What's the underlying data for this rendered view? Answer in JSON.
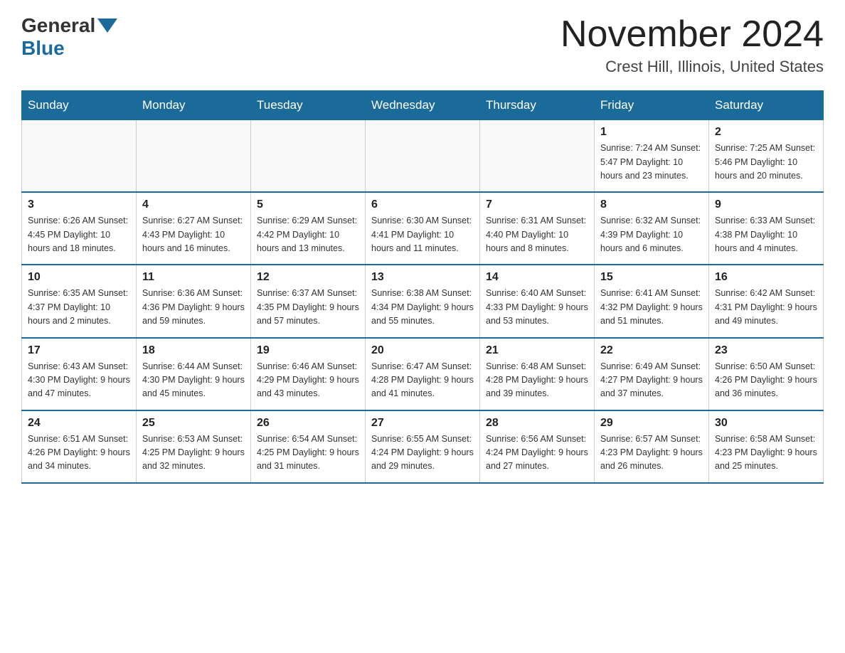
{
  "header": {
    "logo_general": "General",
    "logo_blue": "Blue",
    "month_year": "November 2024",
    "location": "Crest Hill, Illinois, United States"
  },
  "days_of_week": [
    "Sunday",
    "Monday",
    "Tuesday",
    "Wednesday",
    "Thursday",
    "Friday",
    "Saturday"
  ],
  "weeks": [
    [
      {
        "day": "",
        "info": ""
      },
      {
        "day": "",
        "info": ""
      },
      {
        "day": "",
        "info": ""
      },
      {
        "day": "",
        "info": ""
      },
      {
        "day": "",
        "info": ""
      },
      {
        "day": "1",
        "info": "Sunrise: 7:24 AM\nSunset: 5:47 PM\nDaylight: 10 hours and 23 minutes."
      },
      {
        "day": "2",
        "info": "Sunrise: 7:25 AM\nSunset: 5:46 PM\nDaylight: 10 hours and 20 minutes."
      }
    ],
    [
      {
        "day": "3",
        "info": "Sunrise: 6:26 AM\nSunset: 4:45 PM\nDaylight: 10 hours and 18 minutes."
      },
      {
        "day": "4",
        "info": "Sunrise: 6:27 AM\nSunset: 4:43 PM\nDaylight: 10 hours and 16 minutes."
      },
      {
        "day": "5",
        "info": "Sunrise: 6:29 AM\nSunset: 4:42 PM\nDaylight: 10 hours and 13 minutes."
      },
      {
        "day": "6",
        "info": "Sunrise: 6:30 AM\nSunset: 4:41 PM\nDaylight: 10 hours and 11 minutes."
      },
      {
        "day": "7",
        "info": "Sunrise: 6:31 AM\nSunset: 4:40 PM\nDaylight: 10 hours and 8 minutes."
      },
      {
        "day": "8",
        "info": "Sunrise: 6:32 AM\nSunset: 4:39 PM\nDaylight: 10 hours and 6 minutes."
      },
      {
        "day": "9",
        "info": "Sunrise: 6:33 AM\nSunset: 4:38 PM\nDaylight: 10 hours and 4 minutes."
      }
    ],
    [
      {
        "day": "10",
        "info": "Sunrise: 6:35 AM\nSunset: 4:37 PM\nDaylight: 10 hours and 2 minutes."
      },
      {
        "day": "11",
        "info": "Sunrise: 6:36 AM\nSunset: 4:36 PM\nDaylight: 9 hours and 59 minutes."
      },
      {
        "day": "12",
        "info": "Sunrise: 6:37 AM\nSunset: 4:35 PM\nDaylight: 9 hours and 57 minutes."
      },
      {
        "day": "13",
        "info": "Sunrise: 6:38 AM\nSunset: 4:34 PM\nDaylight: 9 hours and 55 minutes."
      },
      {
        "day": "14",
        "info": "Sunrise: 6:40 AM\nSunset: 4:33 PM\nDaylight: 9 hours and 53 minutes."
      },
      {
        "day": "15",
        "info": "Sunrise: 6:41 AM\nSunset: 4:32 PM\nDaylight: 9 hours and 51 minutes."
      },
      {
        "day": "16",
        "info": "Sunrise: 6:42 AM\nSunset: 4:31 PM\nDaylight: 9 hours and 49 minutes."
      }
    ],
    [
      {
        "day": "17",
        "info": "Sunrise: 6:43 AM\nSunset: 4:30 PM\nDaylight: 9 hours and 47 minutes."
      },
      {
        "day": "18",
        "info": "Sunrise: 6:44 AM\nSunset: 4:30 PM\nDaylight: 9 hours and 45 minutes."
      },
      {
        "day": "19",
        "info": "Sunrise: 6:46 AM\nSunset: 4:29 PM\nDaylight: 9 hours and 43 minutes."
      },
      {
        "day": "20",
        "info": "Sunrise: 6:47 AM\nSunset: 4:28 PM\nDaylight: 9 hours and 41 minutes."
      },
      {
        "day": "21",
        "info": "Sunrise: 6:48 AM\nSunset: 4:28 PM\nDaylight: 9 hours and 39 minutes."
      },
      {
        "day": "22",
        "info": "Sunrise: 6:49 AM\nSunset: 4:27 PM\nDaylight: 9 hours and 37 minutes."
      },
      {
        "day": "23",
        "info": "Sunrise: 6:50 AM\nSunset: 4:26 PM\nDaylight: 9 hours and 36 minutes."
      }
    ],
    [
      {
        "day": "24",
        "info": "Sunrise: 6:51 AM\nSunset: 4:26 PM\nDaylight: 9 hours and 34 minutes."
      },
      {
        "day": "25",
        "info": "Sunrise: 6:53 AM\nSunset: 4:25 PM\nDaylight: 9 hours and 32 minutes."
      },
      {
        "day": "26",
        "info": "Sunrise: 6:54 AM\nSunset: 4:25 PM\nDaylight: 9 hours and 31 minutes."
      },
      {
        "day": "27",
        "info": "Sunrise: 6:55 AM\nSunset: 4:24 PM\nDaylight: 9 hours and 29 minutes."
      },
      {
        "day": "28",
        "info": "Sunrise: 6:56 AM\nSunset: 4:24 PM\nDaylight: 9 hours and 27 minutes."
      },
      {
        "day": "29",
        "info": "Sunrise: 6:57 AM\nSunset: 4:23 PM\nDaylight: 9 hours and 26 minutes."
      },
      {
        "day": "30",
        "info": "Sunrise: 6:58 AM\nSunset: 4:23 PM\nDaylight: 9 hours and 25 minutes."
      }
    ]
  ]
}
